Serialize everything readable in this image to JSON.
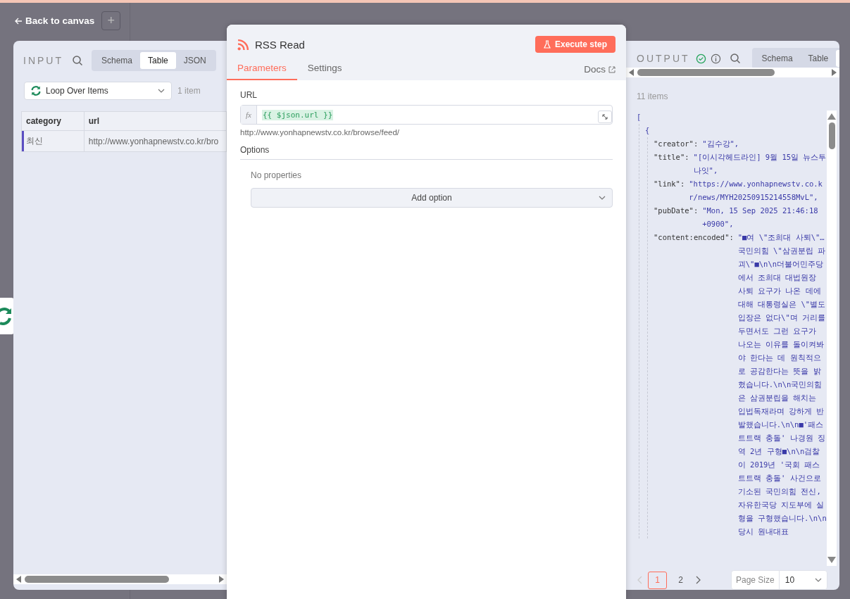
{
  "top_bar": {
    "back_label": "Back to canvas",
    "add_button": "+"
  },
  "input_panel": {
    "title": "INPUT",
    "tabs": [
      {
        "label": "Schema",
        "selected": false
      },
      {
        "label": "Table",
        "selected": true
      },
      {
        "label": "JSON",
        "selected": false
      }
    ],
    "source_node": "Loop Over Items",
    "item_count": "1 item",
    "table": {
      "columns": [
        "category",
        "url"
      ],
      "rows": [
        {
          "cells": [
            "최신",
            "http://www.yonhapnewstv.co.kr/bro"
          ],
          "selected": true
        }
      ]
    }
  },
  "node": {
    "title": "RSS Read",
    "execute_button": "Execute step",
    "tabs": [
      {
        "label": "Parameters",
        "selected": true
      },
      {
        "label": "Settings",
        "selected": false
      }
    ],
    "docs_link": "Docs",
    "url_field": {
      "label": "URL",
      "fx_badge": "fx",
      "value": "{{ $json.url }}",
      "hint": "http://www.yonhapnewstv.co.kr/browse/feed/"
    },
    "options": {
      "label": "Options",
      "empty_text": "No properties",
      "add_button": "Add option"
    }
  },
  "output_panel": {
    "title": "OUTPUT",
    "tabs": [
      {
        "label": "Schema",
        "selected": false
      },
      {
        "label": "Table",
        "selected": false
      }
    ],
    "item_count": "11 items",
    "array_open": "[",
    "object_open": "{",
    "fields": [
      {
        "key": "\"creator\":",
        "value": "\"김수강\","
      },
      {
        "key": "\"title\":",
        "value": "\"[이시각헤드라인] 9월 15일 뉴스투나잇\","
      },
      {
        "key": "\"link\":",
        "value": "\"https://www.yonhapnewstv.co.kr/news/MYH20250915214558MvL\","
      },
      {
        "key": "\"pubDate\":",
        "value": "\"Mon, 15 Sep 2025 21:46:18 +0900\","
      },
      {
        "key": "\"content:encoded\":",
        "value": "\"■여 \\\"조희대 사퇴\\\"…국민의힘 \\\"삼권분립 파괴\\\"■\\n\\n더불어민주당에서 조희대 대법원장 사퇴 요구가 나온 데에 대해 대통령실은 \\\"별도 입장은 없다\\\"며 거리를 두면서도 그런 요구가 나오는 이유를 돌이켜봐야 한다는 데 원칙적으로 공감한다는 뜻을 밝혔습니다.\\n\\n국민의힘은 삼권분립을 해치는 입법독재라며 강하게 반발했습니다.\\n\\n■'패스트트랙 충돌' 나경원 징역 2년 구형■\\n\\n검찰이 2019년 '국회 패스트트랙 충돌' 사건으로 기소된 국민의힘 전신, 자유한국당 지도부에 실형을 구형했습니다.\\n\\n당시 원내대표"
      }
    ],
    "pagination": {
      "pages": [
        {
          "label": "1",
          "selected": true
        },
        {
          "label": "2",
          "selected": false
        }
      ],
      "page_size_label": "Page Size",
      "page_size": "10"
    }
  }
}
